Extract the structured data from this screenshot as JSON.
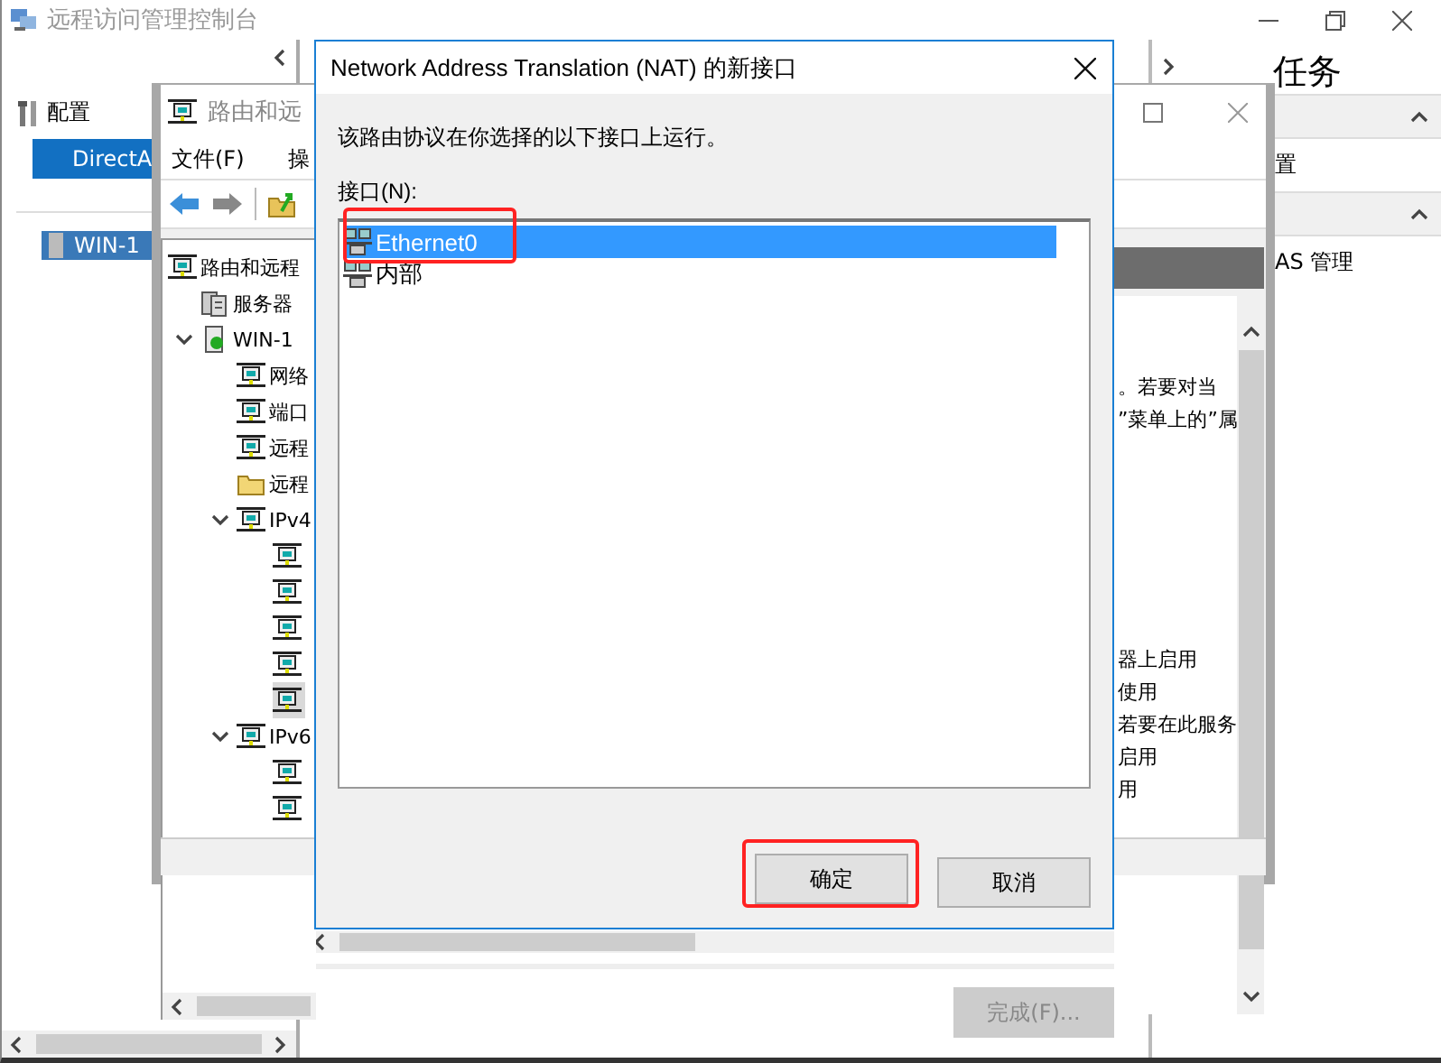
{
  "console": {
    "title": "远程访问管理控制台",
    "nav": [
      {
        "kind": "heading",
        "label": "配置"
      },
      {
        "kind": "button",
        "label": "DirectA"
      },
      {
        "kind": "server",
        "label": "WIN-1",
        "selected": true
      }
    ],
    "tasks": {
      "title": "任务",
      "sections": [
        {
          "label": "置",
          "expanded": true
        },
        {
          "label": "AS 管理",
          "expanded": true
        }
      ]
    },
    "finish_button": {
      "label": "完成(F)...",
      "disabled": true
    }
  },
  "routing_window": {
    "title": "路由和远",
    "menu": [
      "文件(F)",
      "操"
    ],
    "tree": [
      {
        "kind": "computer",
        "label": "路由和远程",
        "selected": false,
        "children": [
          {
            "kind": "servers",
            "label": "服务器",
            "selected": false
          },
          {
            "kind": "host",
            "label": "WIN-1",
            "selected": false,
            "expanded": true,
            "children": [
              {
                "kind": "computer",
                "label": "网络",
                "selected": false
              },
              {
                "kind": "computer",
                "label": "端口",
                "selected": false
              },
              {
                "kind": "computer",
                "label": "远程",
                "selected": false
              },
              {
                "kind": "folder",
                "label": "远程",
                "selected": false
              },
              {
                "kind": "computer",
                "label": "IPv4",
                "selected": false,
                "expanded": true,
                "children": [
                  {
                    "kind": "computer",
                    "selected": false
                  },
                  {
                    "kind": "computer",
                    "selected": false
                  },
                  {
                    "kind": "computer",
                    "selected": false
                  },
                  {
                    "kind": "computer",
                    "selected": false
                  },
                  {
                    "kind": "computer",
                    "selected": true
                  }
                ]
              },
              {
                "kind": "computer",
                "label": "IPv6",
                "selected": false,
                "expanded": true,
                "children": [
                  {
                    "kind": "computer",
                    "selected": false
                  },
                  {
                    "kind": "computer",
                    "selected": false
                  }
                ]
              }
            ]
          }
        ]
      }
    ],
    "description": [
      {
        "lines": [
          "。若要对当",
          "”菜单上的”属"
        ]
      },
      {
        "lines": [
          "器上启用",
          "使用",
          "若要在此服务",
          "启用",
          "用"
        ]
      }
    ]
  },
  "dialog": {
    "title": "Network Address Translation (NAT) 的新接口",
    "message": "该路由协议在你选择的以下接口上运行。",
    "list_label": "接口(N):",
    "interfaces": [
      {
        "label": "Ethernet0",
        "selected": true,
        "highlighted": true
      },
      {
        "label": "内部",
        "selected": false,
        "highlighted": false
      }
    ],
    "buttons": [
      {
        "label": "确定",
        "highlighted": true
      },
      {
        "label": "取消",
        "highlighted": false
      }
    ]
  }
}
